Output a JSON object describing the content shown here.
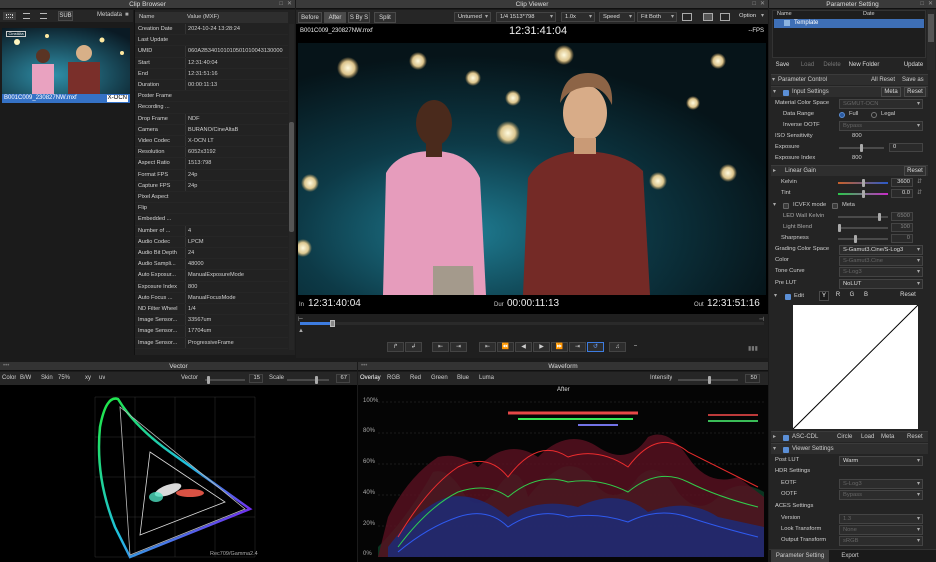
{
  "clip_browser": {
    "title": "Clip Browser",
    "sub": "SUB",
    "metadata_label": "Metadata",
    "clip_name": "B001C009_230827NW.mxf",
    "clip_badge": "X-OCN",
    "col_name": "Name",
    "col_value": "Value (MXF)",
    "rows": [
      {
        "k": "Creation Date",
        "v": "2024-10-24 13:28:24"
      },
      {
        "k": "Last Update",
        "v": ""
      },
      {
        "k": "UMID",
        "v": "060A2B340101010501010043130000"
      },
      {
        "k": "Start",
        "v": "12:31:40:04"
      },
      {
        "k": "End",
        "v": "12:31:51:16"
      },
      {
        "k": "Duration",
        "v": "00:00:11:13"
      },
      {
        "k": "Poster Frame",
        "v": ""
      },
      {
        "k": "Recording ...",
        "v": ""
      },
      {
        "k": "Drop Frame",
        "v": "NDF"
      },
      {
        "k": "Camera",
        "v": "BURANO/CineAltaB"
      },
      {
        "k": "Video Codec",
        "v": "X-OCN LT"
      },
      {
        "k": "Resolution",
        "v": "6052x3192"
      },
      {
        "k": "Aspect Ratio",
        "v": "1513:798"
      },
      {
        "k": "Format FPS",
        "v": "24p"
      },
      {
        "k": "Capture FPS",
        "v": "24p"
      },
      {
        "k": "Pixel Aspect",
        "v": ""
      },
      {
        "k": "Flip",
        "v": ""
      },
      {
        "k": "Embedded ...",
        "v": ""
      },
      {
        "k": "Number of ...",
        "v": "4"
      },
      {
        "k": "Audio Codec",
        "v": "LPCM"
      },
      {
        "k": "Audio Bit Depth",
        "v": "24"
      },
      {
        "k": "Audio Sampli...",
        "v": "48000"
      },
      {
        "k": "Auto Exposur...",
        "v": "ManualExposureMode"
      },
      {
        "k": "Exposure Index",
        "v": "800"
      },
      {
        "k": "Auto Focus ...",
        "v": "ManualFocusMode"
      },
      {
        "k": "ND Filter Wheel",
        "v": "1/4"
      },
      {
        "k": "Image Sensor...",
        "v": "33567um"
      },
      {
        "k": "Image Sensor...",
        "v": "17704um"
      },
      {
        "k": "Image Sensor...",
        "v": "ProgressiveFrame"
      }
    ]
  },
  "clip_viewer": {
    "title": "Clip Viewer",
    "tabs": [
      "Before",
      "After",
      "S By S",
      "Split"
    ],
    "unturned": "Unturned",
    "ratio": "1/4 1513*798",
    "zoom": "1.0x",
    "speed": "Speed",
    "fit": "Fit Both",
    "option": "Option",
    "filename": "B001C009_230827NW.mxf",
    "timecode": "12:31:41:04",
    "fps": "--FPS",
    "in_label": "In",
    "in_tc": "12:31:40:04",
    "dur_label": "Dur",
    "dur_tc": "00:00:11:13",
    "out_label": "Out",
    "out_tc": "12:31:51:16",
    "playhead_fraction": 0.07
  },
  "vector": {
    "title": "Vector",
    "color": "Color",
    "bw": "B/W",
    "skin": "Skin",
    "skin_pct": "75%",
    "xy": "xy",
    "uv": "uv",
    "vector_label": "Vector",
    "vector_val": "15",
    "scale_label": "Scale",
    "scale_val": "67",
    "footer": "Rec709/Gamma2.4"
  },
  "waveform": {
    "title": "Waveform",
    "tabs": [
      "Overlay",
      "RGB",
      "Red",
      "Green",
      "Blue",
      "Luma"
    ],
    "intensity_label": "Intensity",
    "intensity_val": "50",
    "heading": "After",
    "scale": [
      "100%",
      "80%",
      "60%",
      "40%",
      "20%",
      "0%"
    ]
  },
  "param": {
    "title": "Parameter Setting",
    "col_name": "Name",
    "col_date": "Date",
    "template": "Template",
    "buttons": {
      "save": "Save",
      "load": "Load",
      "delete": "Delete",
      "new_folder": "New Folder",
      "update": "Update"
    },
    "control": "Parameter Control",
    "all_reset": "All Reset",
    "save_as": "Save as",
    "input_settings": "Input Settings",
    "meta": "Meta",
    "reset": "Reset",
    "material_color_space": "Material Color Space",
    "material_color_space_val": "SGMUT-OCN",
    "data_range": "Data Range",
    "full": "Full",
    "legal": "Legal",
    "inverse_ootf": "Inverse OOTF",
    "inverse_ootf_val": "Bypass",
    "iso": "ISO Sensitivity",
    "iso_val": "800",
    "exposure": "Exposure",
    "exposure_val": "0",
    "exposure_index": "Exposure Index",
    "exposure_index_val": "800",
    "linear_gain": "Linear Gain",
    "kelvin": "Kelvin",
    "kelvin_val": "3600",
    "tint": "Tint",
    "tint_val": "0.0",
    "icvfx": "ICVFX mode",
    "led_kelvin": "LED Wall Kelvin",
    "led_kelvin_val": "6500",
    "light_blend": "Light Blend",
    "light_blend_val": "100",
    "sharpness": "Sharpness",
    "sharpness_val": "0",
    "grading_cs": "Grading Color Space",
    "grading_cs_val": "S-Gamut3.Cine/S-Log3",
    "color": "Color",
    "color_val": "S-Gamut3.Cine",
    "tone_curve": "Tone Curve",
    "tone_curve_val": "S-Log3",
    "pre_lut": "Pre LUT",
    "pre_lut_val": "NoLUT",
    "edit": "Edit",
    "y": "Y",
    "r": "R",
    "g": "G",
    "b": "B",
    "asc_cdl": "ASC-CDL",
    "circle": "Circle",
    "load": "Load",
    "viewer_settings": "Viewer Settings",
    "post_lut": "Post LUT",
    "post_lut_val": "Warm",
    "hdr_settings": "HDR Settings",
    "eotf": "EOTF",
    "eotf_val": "S-Log3",
    "ootf": "OOTF",
    "ootf_val": "Bypass",
    "aces": "ACES Settings",
    "version": "Version",
    "version_val": "1.3",
    "look": "Look Transform",
    "look_val": "None",
    "output": "Output Transform",
    "output_val": "sRGB",
    "tab_param": "Parameter Setting",
    "tab_export": "Export"
  }
}
